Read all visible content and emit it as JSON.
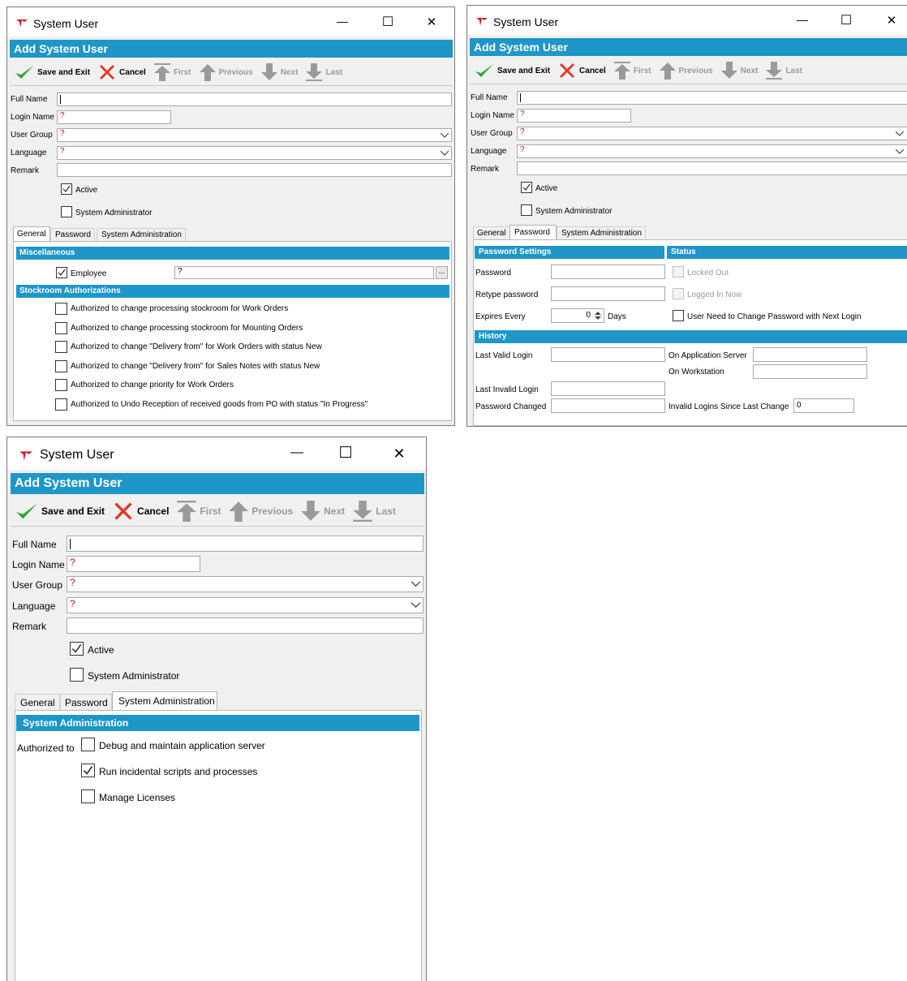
{
  "colors": {
    "header_blue": "#1e96c8",
    "required_mark": "#d01010",
    "save_green": "#2ca836",
    "cancel_red": "#e03a2a",
    "nav_gray": "#9a9a9a",
    "app_icon_red": "#c8202a"
  },
  "icons": {
    "app": "app-logo-icon",
    "minimize": "minimize-icon",
    "maximize": "maximize-icon",
    "close": "close-icon",
    "save": "checkmark-icon",
    "cancel": "cross-icon",
    "first": "arrow-top-icon",
    "previous": "arrow-up-icon",
    "next": "arrow-down-icon",
    "last": "arrow-bottom-icon",
    "dropdown": "chevron-down-icon",
    "ellipsis": "ellipsis-icon",
    "spinner": "spinner-icon"
  },
  "window": {
    "title": "System User",
    "header": "Add System User",
    "minimize": "—",
    "maximize": "☐",
    "close": "✕",
    "toolbar": {
      "save": "Save and Exit",
      "cancel": "Cancel",
      "first": "First",
      "previous": "Previous",
      "next": "Next",
      "last": "Last"
    },
    "form": {
      "full_name_label": "Full Name",
      "full_name_value": "",
      "login_name_label": "Login Name",
      "login_name_value": "?",
      "user_group_label": "User Group",
      "user_group_value": "?",
      "language_label": "Language",
      "language_value": "?",
      "remark_label": "Remark",
      "remark_value": "",
      "active_label": "Active",
      "active_checked": true,
      "sysadmin_label": "System Administrator",
      "sysadmin_checked": false
    },
    "tabs": [
      "General",
      "Password",
      "System Administration"
    ]
  },
  "general": {
    "misc_header": "Miscellaneous",
    "employee_label": "Employee",
    "employee_checked": true,
    "employee_value": "?",
    "ellipsis": "...",
    "stock_header": "Stockroom Authorizations",
    "auth": [
      {
        "label": "Authorized to change processing stockroom for Work Orders",
        "checked": false
      },
      {
        "label": "Authorized to change processing stockroom for Mounting Orders",
        "checked": false
      },
      {
        "label": "Authorized to change \"Delivery from\" for Work Orders with status New",
        "checked": false
      },
      {
        "label": "Authorized to change \"Delivery from\" for Sales Notes with status New",
        "checked": false
      },
      {
        "label": "Authorized to change priority for Work Orders",
        "checked": false
      },
      {
        "label": "Authorized to Undo Reception of received goods from PO with status \"In Progress\"",
        "checked": false
      }
    ]
  },
  "password": {
    "settings_header": "Password Settings",
    "status_header": "Status",
    "password_label": "Password",
    "retype_label": "Retype password",
    "expires_label": "Expires Every",
    "expires_value": "0",
    "days_label": "Days",
    "locked_out": "Locked Out",
    "logged_in": "Logged In Now",
    "need_change": "User Need to Change Password with Next Login",
    "history_header": "History",
    "last_valid": "Last Valid Login",
    "app_server": "On Application Server",
    "workstation": "On Workstation",
    "last_invalid": "Last Invalid Login",
    "pw_changed": "Password Changed",
    "invalid_logins": "Invalid Logins Since Last Change",
    "invalid_value": "0"
  },
  "sysadmin": {
    "header": "System Administration",
    "authorized_to": "Authorized to",
    "items": [
      {
        "label": "Debug and maintain application server",
        "checked": false
      },
      {
        "label": "Run incidental scripts and processes",
        "checked": true
      },
      {
        "label": "Manage Licenses",
        "checked": false
      }
    ]
  }
}
